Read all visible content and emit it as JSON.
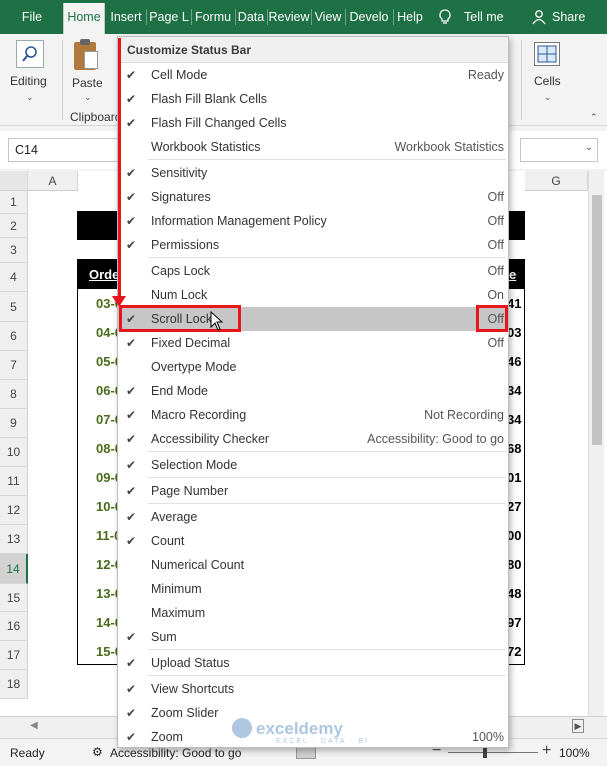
{
  "tabs": [
    {
      "label": "File",
      "active": false
    },
    {
      "label": "Home",
      "active": true
    },
    {
      "label": "Insert",
      "active": false
    },
    {
      "label": "Page L",
      "active": false
    },
    {
      "label": "Formu",
      "active": false
    },
    {
      "label": "Data",
      "active": false
    },
    {
      "label": "Review",
      "active": false
    },
    {
      "label": "View",
      "active": false
    },
    {
      "label": "Develo",
      "active": false
    },
    {
      "label": "Help",
      "active": false
    }
  ],
  "tell_me": "Tell me",
  "share": "Share",
  "ribbon": {
    "editing": "Editing",
    "paste": "Paste",
    "clipboard": "Clipboard",
    "cells": "Cells"
  },
  "namebox": "C14",
  "columns": [
    "A",
    "G"
  ],
  "rows": [
    "1",
    "2",
    "3",
    "4",
    "5",
    "6",
    "7",
    "8",
    "9",
    "10",
    "11",
    "12",
    "13",
    "14",
    "15",
    "16",
    "17",
    "18"
  ],
  "selected_row": "14",
  "sheet_cells": {
    "header_left": "Orde",
    "header_right": "e",
    "left_values": [
      "03-0",
      "04-0",
      "05-0",
      "06-0",
      "07-0",
      "08-0",
      "09-0",
      "10-0",
      "11-0",
      "12-0",
      "13-0",
      "14-0",
      "15-0"
    ],
    "right_values": [
      "41",
      "03",
      "46",
      "34",
      "34",
      "68",
      "01",
      "27",
      "00",
      "80",
      "48",
      "97",
      "72"
    ]
  },
  "menu": {
    "title": "Customize Status Bar",
    "items": [
      {
        "label": "Cell Mode",
        "value": "Ready",
        "checked": true
      },
      {
        "label": "Flash Fill Blank Cells",
        "value": "",
        "checked": true
      },
      {
        "label": "Flash Fill Changed Cells",
        "value": "",
        "checked": true
      },
      {
        "label": "Workbook Statistics",
        "value": "Workbook Statistics",
        "checked": false
      },
      {
        "label": "Sensitivity",
        "value": "",
        "checked": true
      },
      {
        "label": "Signatures",
        "value": "Off",
        "checked": true
      },
      {
        "label": "Information Management Policy",
        "value": "Off",
        "checked": true
      },
      {
        "label": "Permissions",
        "value": "Off",
        "checked": true
      },
      {
        "label": "Caps Lock",
        "value": "Off",
        "checked": false
      },
      {
        "label": "Num Lock",
        "value": "On",
        "checked": false
      },
      {
        "label": "Scroll Lock",
        "value": "Off",
        "checked": true
      },
      {
        "label": "Fixed Decimal",
        "value": "Off",
        "checked": true
      },
      {
        "label": "Overtype Mode",
        "value": "",
        "checked": false
      },
      {
        "label": "End Mode",
        "value": "",
        "checked": true
      },
      {
        "label": "Macro Recording",
        "value": "Not Recording",
        "checked": true
      },
      {
        "label": "Accessibility Checker",
        "value": "Accessibility: Good to go",
        "checked": true
      },
      {
        "label": "Selection Mode",
        "value": "",
        "checked": true
      },
      {
        "label": "Page Number",
        "value": "",
        "checked": true
      },
      {
        "label": "Average",
        "value": "",
        "checked": true
      },
      {
        "label": "Count",
        "value": "",
        "checked": true
      },
      {
        "label": "Numerical Count",
        "value": "",
        "checked": false
      },
      {
        "label": "Minimum",
        "value": "",
        "checked": false
      },
      {
        "label": "Maximum",
        "value": "",
        "checked": false
      },
      {
        "label": "Sum",
        "value": "",
        "checked": true
      },
      {
        "label": "Upload Status",
        "value": "",
        "checked": true
      },
      {
        "label": "View Shortcuts",
        "value": "",
        "checked": true
      },
      {
        "label": "Zoom Slider",
        "value": "",
        "checked": true
      },
      {
        "label": "Zoom",
        "value": "100%",
        "checked": true
      }
    ],
    "highlighted": "Scroll Lock"
  },
  "status": {
    "ready": "Ready",
    "accessibility": "Accessibility: Good to go",
    "zoom": "100%"
  },
  "watermark": {
    "brand": "exceldemy",
    "tagline": "EXCEL · DATA · BI"
  },
  "colors": {
    "accent": "#1e7145",
    "highlight": "#e8161b"
  }
}
